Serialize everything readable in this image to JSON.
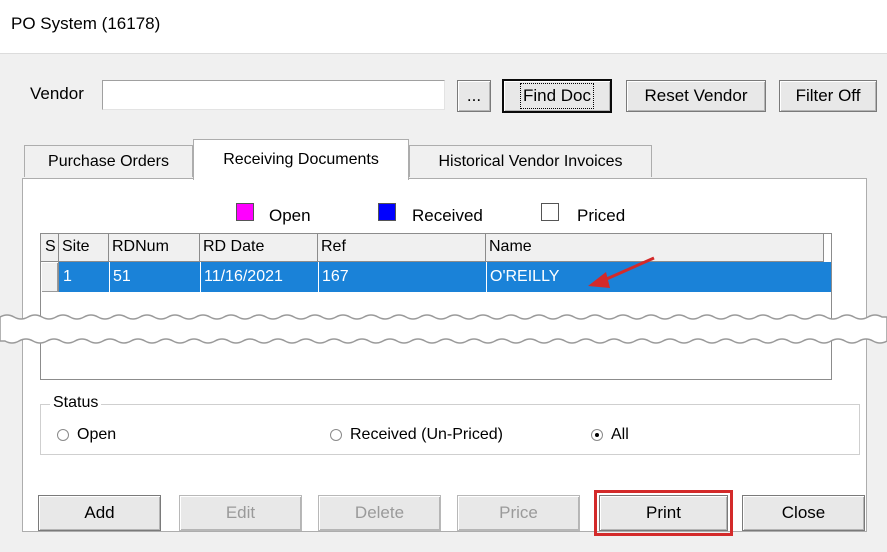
{
  "window": {
    "title": "PO System (16178)"
  },
  "vendor": {
    "label": "Vendor",
    "value": "",
    "browse_label": "..."
  },
  "toolbar": {
    "find_doc": "Find Doc",
    "reset_vendor": "Reset Vendor",
    "filter_off": "Filter Off"
  },
  "tabs": [
    {
      "label": "Purchase Orders",
      "active": false
    },
    {
      "label": "Receiving Documents",
      "active": true
    },
    {
      "label": "Historical Vendor Invoices",
      "active": false
    }
  ],
  "legend": [
    {
      "label": "Open",
      "color": "#ff00ff"
    },
    {
      "label": "Received",
      "color": "#0000ff"
    },
    {
      "label": "Priced",
      "color": "#ffffff"
    }
  ],
  "grid": {
    "columns": [
      "S",
      "Site",
      "RDNum",
      "RD Date",
      "Ref",
      "Name"
    ],
    "rows": [
      {
        "site": "1",
        "rdnum": "51",
        "rd_date": "11/16/2021",
        "ref": "167",
        "name": "O'REILLY"
      }
    ]
  },
  "status": {
    "label": "Status",
    "options": [
      {
        "label": "Open",
        "checked": false
      },
      {
        "label": "Received (Un-Priced)",
        "checked": false
      },
      {
        "label": "All",
        "checked": true
      }
    ]
  },
  "actions": {
    "add": "Add",
    "edit": "Edit",
    "delete": "Delete",
    "price": "Price",
    "print": "Print",
    "close": "Close"
  },
  "colors": {
    "selection": "#1a82d8",
    "callout_red": "#d32a2a"
  }
}
